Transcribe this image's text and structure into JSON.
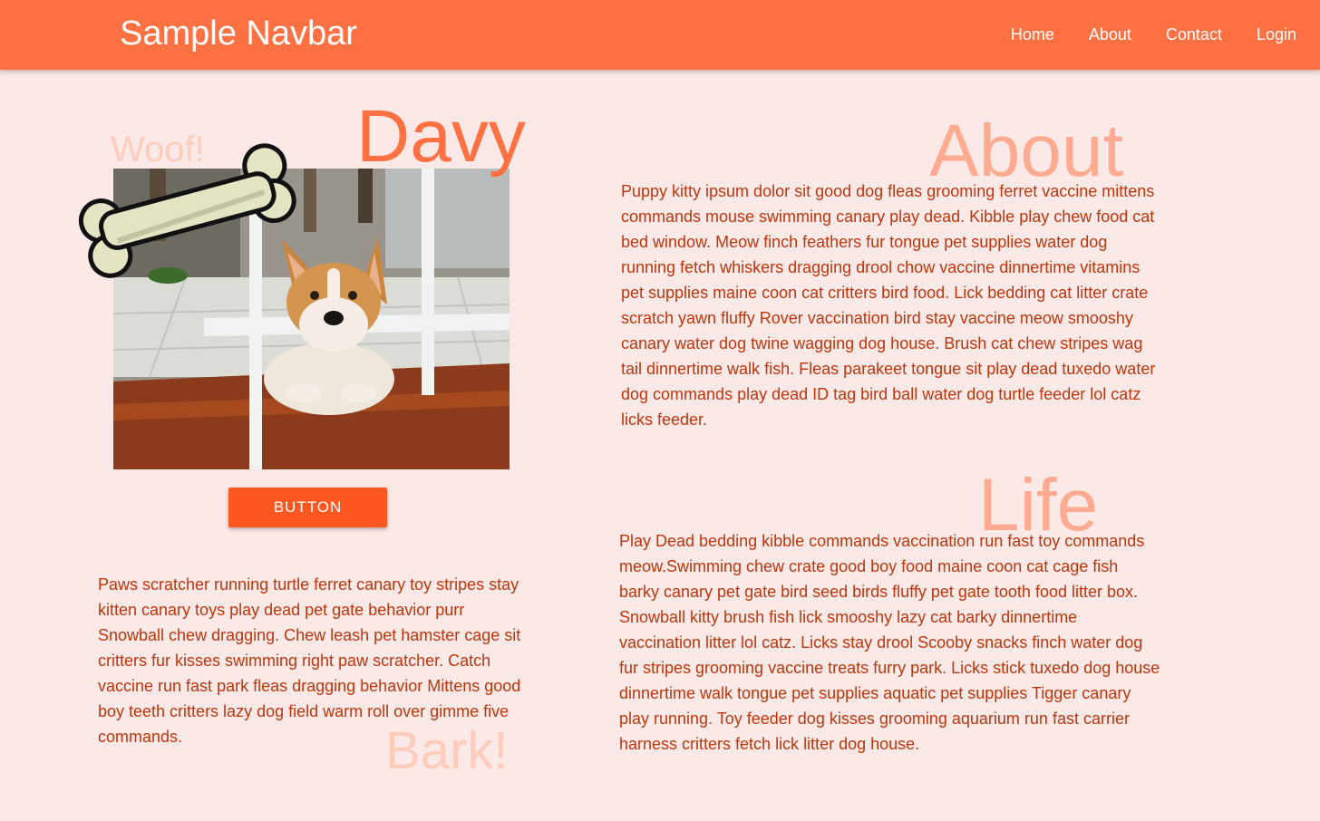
{
  "navbar": {
    "brand": "Sample Navbar",
    "links": [
      "Home",
      "About",
      "Contact",
      "Login"
    ]
  },
  "hero": {
    "woof": "Woof!",
    "name": "Davy",
    "button_label": "BUTTON"
  },
  "about": {
    "title": "About",
    "text": "Puppy kitty ipsum dolor sit good dog fleas grooming ferret vaccine mittens commands mouse swimming canary play dead. Kibble play chew food cat bed window. Meow finch feathers fur tongue pet supplies water dog running fetch whiskers dragging drool chow vaccine dinnertime vitamins pet supplies maine coon cat critters bird food. Lick bedding cat litter crate scratch yawn fluffy Rover vaccination bird stay vaccine meow smooshy canary water dog twine wagging dog house. Brush cat chew stripes wag tail dinnertime walk fish. Fleas parakeet tongue sit play dead tuxedo water dog commands play dead ID tag bird ball water dog turtle feeder lol catz licks feeder."
  },
  "life": {
    "title": "Life",
    "text": "Play Dead bedding kibble commands vaccination run fast toy commands meow.Swimming chew crate good boy food maine coon cat cage fish barky canary pet gate bird seed birds fluffy pet gate tooth food litter box. Snowball kitty brush fish lick smooshy lazy cat barky dinnertime vaccination litter lol catz. Licks stay drool Scooby snacks finch water dog fur stripes grooming vaccine treats furry park. Licks stick tuxedo dog house dinnertime walk tongue pet supplies aquatic pet supplies Tigger canary play running. Toy feeder dog kisses grooming aquarium run fast carrier harness critters fetch lick litter dog house."
  },
  "bark": {
    "title": "Bark!",
    "text": "Paws scratcher running turtle ferret canary toy stripes stay kitten canary toys play dead pet gate behavior purr Snowball chew dragging. Chew leash pet hamster cage sit critters fur kisses swimming right paw scratcher. Catch vaccine run fast park fleas dragging behavior Mittens good boy teeth critters lazy dog field warm roll over gimme five commands."
  },
  "colors": {
    "navbar": "#ff7043",
    "background": "#fbe9e7",
    "button": "#ff5722",
    "text": "#bf360c",
    "heading_light": "#ffab91",
    "heading_pale": "#ffccbc"
  },
  "icons": {
    "bone": "bone-icon",
    "photo": "corgi-photo"
  }
}
